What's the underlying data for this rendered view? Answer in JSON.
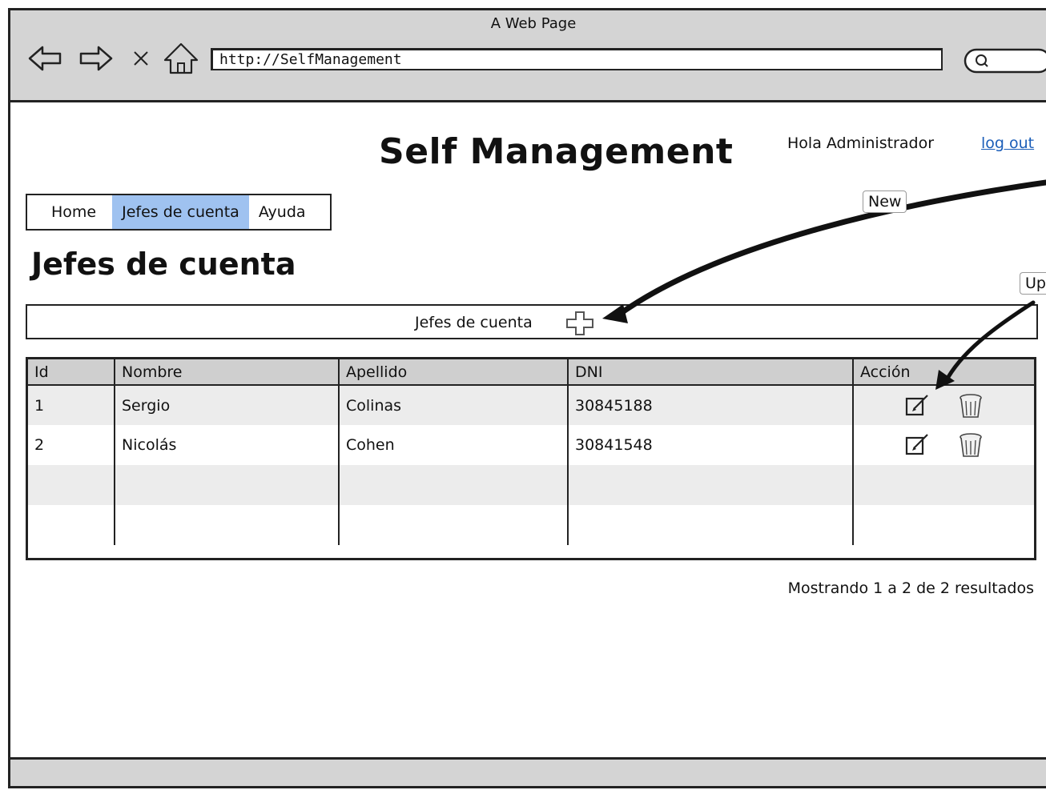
{
  "window": {
    "title": "A Web Page",
    "url": "http://SelfManagement"
  },
  "icons": {
    "back": "back-arrow-icon",
    "forward": "forward-arrow-icon",
    "close": "close-x-icon",
    "home": "home-icon",
    "search": "search-icon",
    "add": "plus-icon",
    "edit": "edit-icon",
    "delete": "trash-icon"
  },
  "header": {
    "app_title": "Self Management",
    "greeting": "Hola Administrador",
    "logout": "log out"
  },
  "menu": {
    "items": [
      {
        "label": "Home",
        "active": false
      },
      {
        "label": "Jefes de cuenta",
        "active": true
      },
      {
        "label": "Ayuda",
        "active": false
      }
    ]
  },
  "page": {
    "heading": "Jefes de cuenta",
    "group_label": "Jefes de cuenta"
  },
  "table": {
    "columns": [
      "Id",
      "Nombre",
      "Apellido",
      "DNI",
      "Acción"
    ],
    "rows": [
      [
        "1",
        "Sergio",
        "Colinas",
        "30845188"
      ],
      [
        "2",
        "Nicolás",
        "Cohen",
        "30841548"
      ]
    ]
  },
  "pagination": {
    "summary": "Mostrando 1 a 2 de 2 resultados"
  },
  "annotations": {
    "new_callout": "New",
    "update_callout": "Up"
  },
  "colors": {
    "active_tab": "#9fc2f0",
    "chrome": "#d4d4d4",
    "header_row": "#cfcfcf",
    "link": "#1a5db8"
  }
}
